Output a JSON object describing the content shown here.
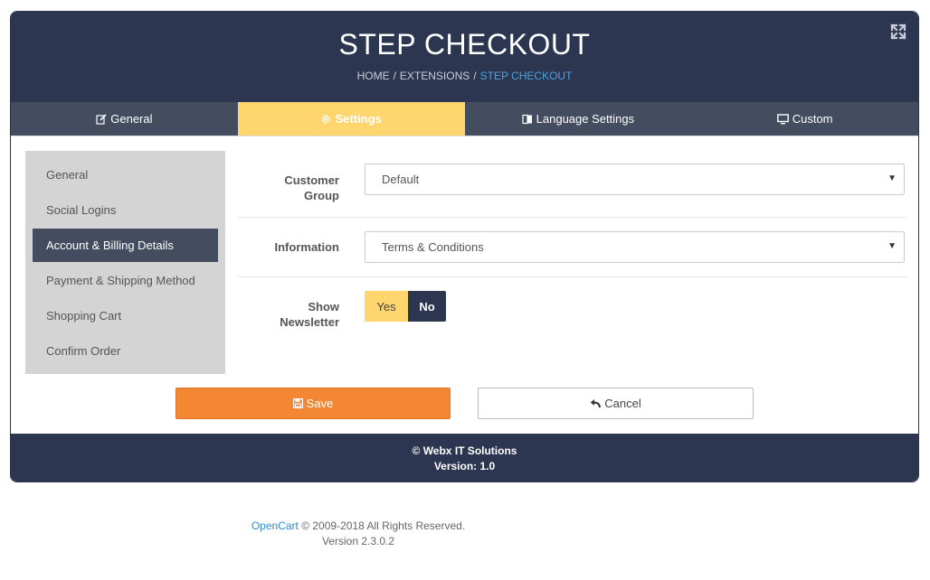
{
  "header": {
    "title": "STEP CHECKOUT",
    "breadcrumb": [
      "HOME",
      "EXTENSIONS",
      "STEP CHECKOUT"
    ],
    "separator": "/"
  },
  "tabs": [
    {
      "label": "General",
      "icon": "edit-icon",
      "active": false
    },
    {
      "label": "Settings",
      "icon": "gear-icon",
      "active": true
    },
    {
      "label": "Language Settings",
      "icon": "language-icon",
      "active": false
    },
    {
      "label": "Custom",
      "icon": "monitor-icon",
      "active": false
    }
  ],
  "sidemenu": {
    "items": [
      {
        "label": "General",
        "active": false
      },
      {
        "label": "Social Logins",
        "active": false
      },
      {
        "label": "Account & Billing Details",
        "active": true
      },
      {
        "label": "Payment & Shipping Method",
        "active": false
      },
      {
        "label": "Shopping Cart",
        "active": false
      },
      {
        "label": "Confirm Order",
        "active": false
      }
    ]
  },
  "form": {
    "customer_group": {
      "label": "Customer Group",
      "value": "Default"
    },
    "information": {
      "label": "Information",
      "value": "Terms & Conditions"
    },
    "show_newsletter": {
      "label": "Show Newsletter",
      "yes": "Yes",
      "no": "No",
      "selected": "Yes"
    }
  },
  "buttons": {
    "save": "Save",
    "cancel": "Cancel"
  },
  "footer": {
    "line1": "© Webx IT Solutions",
    "line2": "Version: 1.0"
  },
  "page_footer": {
    "link": "OpenCart",
    "copyright": " © 2009-2018 All Rights Reserved.",
    "version": "Version 2.3.0.2"
  },
  "colors": {
    "header_bg": "#2d3650",
    "tab_bar_bg": "#444c5f",
    "accent_yellow": "#ffd56e",
    "save_orange": "#f38733",
    "breadcrumb_active": "#4aa3df",
    "link_blue": "#2a8ad4"
  }
}
